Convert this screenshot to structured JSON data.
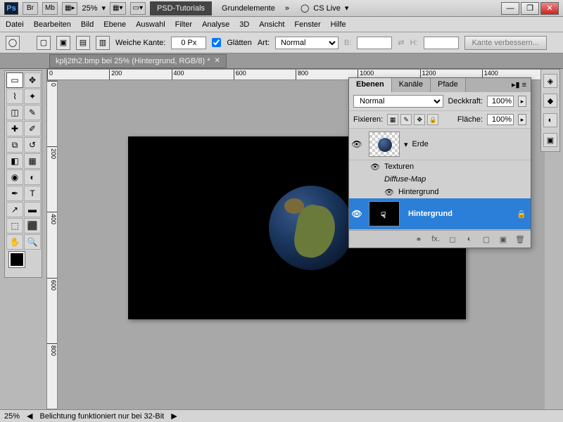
{
  "top": {
    "ps": "Ps",
    "br": "Br",
    "mb": "Mb",
    "zoom": "25%",
    "tab1": "PSD-Tutorials",
    "tab2": "Grundelemente",
    "cslive": "CS Live"
  },
  "menu": [
    "Datei",
    "Bearbeiten",
    "Bild",
    "Ebene",
    "Auswahl",
    "Filter",
    "Analyse",
    "3D",
    "Ansicht",
    "Fenster",
    "Hilfe"
  ],
  "opts": {
    "weiche": "Weiche Kante:",
    "weiche_val": "0 Px",
    "glatten": "Glätten",
    "art": "Art:",
    "art_val": "Normal",
    "b": "B:",
    "h": "H:",
    "kante": "Kante verbessern..."
  },
  "doc": {
    "title": "kplj2th2.bmp bei 25% (Hintergrund, RGB/8) *"
  },
  "ruler_h": [
    "0",
    "200",
    "400",
    "600",
    "800",
    "1000",
    "1200",
    "1400"
  ],
  "ruler_v": [
    "0",
    "200",
    "400",
    "600",
    "800"
  ],
  "layers": {
    "tabs": [
      "Ebenen",
      "Kanäle",
      "Pfade"
    ],
    "blend": "Normal",
    "deck_lbl": "Deckkraft:",
    "deck": "100%",
    "fix_lbl": "Fixieren:",
    "flache_lbl": "Fläche:",
    "flache": "100%",
    "l1": "Erde",
    "grp": "Texturen",
    "diffuse": "Diffuse-Map",
    "hbg": "Hintergrund",
    "l2": "Hintergrund"
  },
  "status": {
    "zoom": "25%",
    "msg": "Belichtung funktioniert nur bei 32-Bit"
  }
}
